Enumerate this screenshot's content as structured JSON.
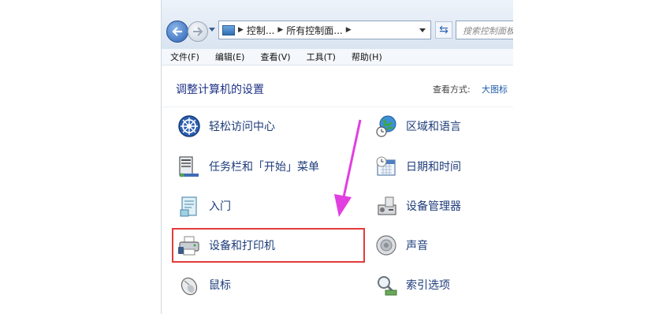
{
  "address_bar": {
    "crumbs": [
      "控制...",
      "所有控制面..."
    ],
    "search_placeholder": "搜索控制面板"
  },
  "menu": [
    "文件(F)",
    "编辑(E)",
    "查看(V)",
    "工具(T)",
    "帮助(H)"
  ],
  "page": {
    "heading": "调整计算机的设置",
    "view_label": "查看方式:",
    "view_value": "大图标"
  },
  "items_left": [
    {
      "label": "轻松访问中心",
      "icon": "ease-of-access-icon"
    },
    {
      "label": "任务栏和「开始」菜单",
      "icon": "taskbar-icon"
    },
    {
      "label": "入门",
      "icon": "getting-started-icon"
    },
    {
      "label": "设备和打印机",
      "icon": "printer-icon"
    },
    {
      "label": "鼠标",
      "icon": "mouse-icon"
    }
  ],
  "items_right": [
    {
      "label": "区域和语言",
      "icon": "globe-clock-icon"
    },
    {
      "label": "日期和时间",
      "icon": "calendar-clock-icon"
    },
    {
      "label": "设备管理器",
      "icon": "device-manager-icon"
    },
    {
      "label": "声音",
      "icon": "speaker-icon"
    },
    {
      "label": "索引选项",
      "icon": "indexing-icon"
    }
  ],
  "colors": {
    "highlight_box": "#e53a3a",
    "arrow": "#e23fe0",
    "link_text": "#1e3c7a"
  }
}
